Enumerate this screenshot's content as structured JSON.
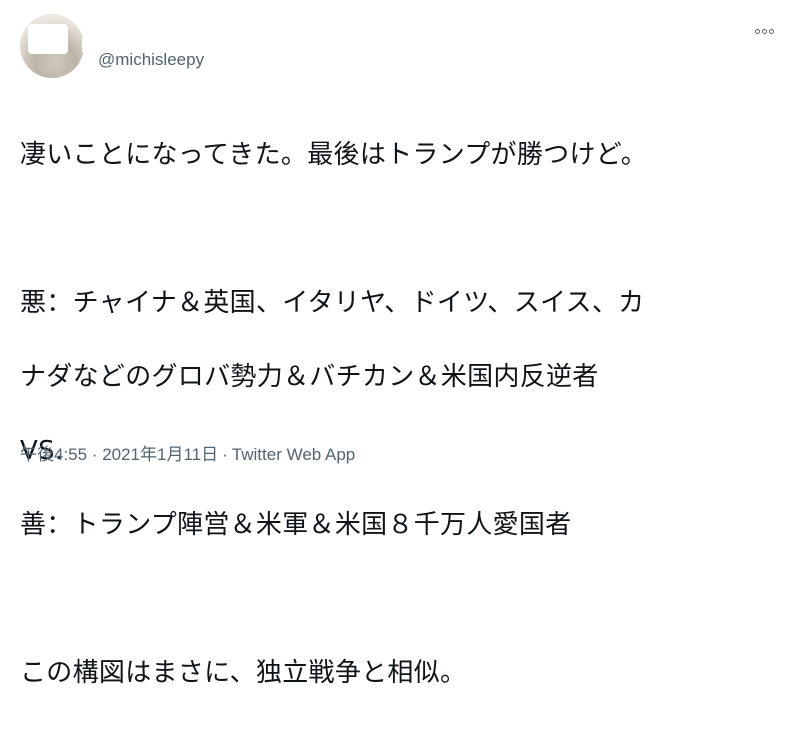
{
  "tweet": {
    "handle": "@michisleepy",
    "lines": [
      "凄いことになってきた。最後はトランプが勝つけど。",
      "",
      "悪：チャイナ＆英国、イタリヤ、ドイツ、スイス、カ",
      "ナダなどのグロバ勢力＆バチカン＆米国内反逆者",
      "VS.",
      "善：トランプ陣営＆米軍＆米国８千万人愛国者",
      "",
      "この構図はまさに、独立戦争と相似。"
    ],
    "timestamp": "午後4:55 · 2021年1月11日",
    "separator": "·",
    "source": "Twitter Web App"
  },
  "icons": {
    "more": "more-horizontal-icon",
    "avatar": "avatar-image"
  },
  "colors": {
    "text": "#0f1419",
    "secondary": "#536471",
    "background": "#ffffff"
  }
}
